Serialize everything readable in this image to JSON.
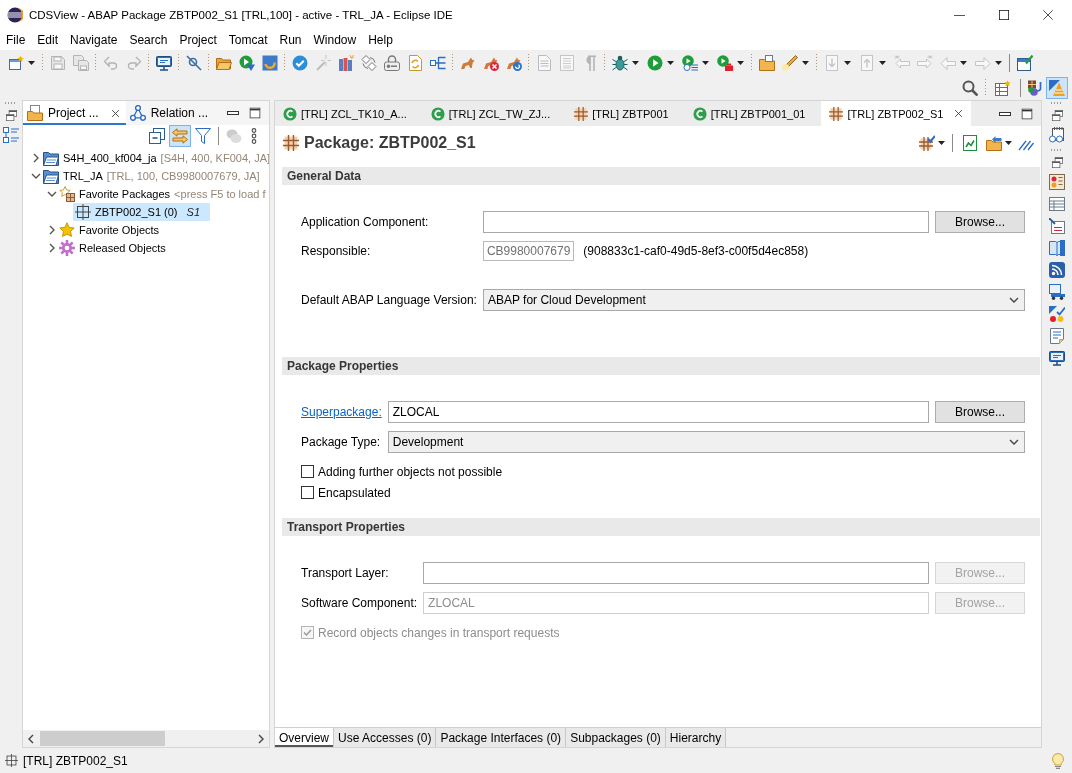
{
  "window": {
    "title": "CDSView - ABAP Package ZBTP002_S1 [TRL,100] - active - TRL_JA - Eclipse IDE"
  },
  "menu": [
    "File",
    "Edit",
    "Navigate",
    "Search",
    "Project",
    "Tomcat",
    "Run",
    "Window",
    "Help"
  ],
  "toolbar": {
    "groups": [
      [
        {
          "disabled": false
        }
      ],
      [
        {
          "disabled": true
        },
        {
          "disabled": true
        }
      ],
      [
        {
          "disabled": true
        },
        {
          "disabled": true
        }
      ],
      [
        {
          "disabled": false
        }
      ],
      [
        {
          "disabled": false
        }
      ],
      [
        {
          "disabled": false
        },
        {
          "disabled": false
        },
        {
          "disabled": false
        }
      ],
      [
        {
          "disabled": false
        },
        {
          "disabled": true
        },
        {
          "disabled": false
        },
        {
          "disabled": false
        },
        {
          "disabled": false
        },
        {
          "disabled": false
        },
        {
          "disabled": false
        }
      ],
      [
        {
          "disabled": false
        },
        {
          "disabled": false
        },
        {
          "disabled": false
        }
      ],
      [
        {
          "disabled": true
        },
        {
          "disabled": true
        },
        {
          "disabled": true
        }
      ],
      [
        {
          "disabled": false
        },
        {
          "disabled": false
        },
        {
          "disabled": false
        },
        {
          "disabled": false
        }
      ],
      [
        {
          "disabled": false
        },
        {
          "disabled": false
        }
      ],
      [
        {
          "disabled": true
        },
        {
          "disabled": true
        },
        {
          "disabled": true
        },
        {
          "disabled": true
        },
        {
          "disabled": true
        },
        {
          "disabled": true
        }
      ],
      [
        {
          "disabled": false
        }
      ]
    ]
  },
  "perspectives": [
    {
      "selected": false
    },
    {
      "selected": true
    }
  ],
  "left_panel": {
    "tabs": [
      {
        "label": "Project ...",
        "selected": true
      },
      {
        "label": "Relation ...",
        "selected": false
      }
    ],
    "toolbar": [
      {
        "on": false,
        "disabled": false
      },
      {
        "on": true,
        "disabled": false
      },
      {
        "on": false,
        "disabled": false
      },
      {
        "on": false,
        "disabled": true
      }
    ],
    "tree": [
      {
        "kind": "project",
        "label": "S4H_400_kf004_ja",
        "detail": "[S4H, 400, KF004, JA]",
        "expanded": false,
        "selected": false
      },
      {
        "kind": "project",
        "label": "TRL_JA",
        "detail": "[TRL, 100, CB9980007679, JA]",
        "expanded": true,
        "selected": false,
        "children": [
          {
            "kind": "packages",
            "label": "Favorite Packages",
            "detail": "<press F5 to load f",
            "expanded": true,
            "selected": false,
            "children": [
              {
                "kind": "package",
                "label": "ZBTP002_S1 (0)",
                "detail": "S1",
                "selected": true
              }
            ]
          },
          {
            "kind": "objects",
            "label": "Favorite Objects",
            "expanded": false,
            "selected": false
          },
          {
            "kind": "released",
            "label": "Released Objects",
            "expanded": false,
            "selected": false
          }
        ]
      }
    ]
  },
  "editor": {
    "tabs": [
      {
        "kind": "class",
        "label": "[TRL] ZCL_TK10_A...",
        "selected": false
      },
      {
        "kind": "class",
        "label": "[TRL] ZCL_TW_ZJ...",
        "selected": false
      },
      {
        "kind": "package",
        "label": "[TRL] ZBTP001",
        "selected": false
      },
      {
        "kind": "class",
        "label": "[TRL] ZBTP001_01",
        "selected": false
      },
      {
        "kind": "package",
        "label": "[TRL] ZBTP002_S1",
        "selected": true
      }
    ],
    "title": "Package: ZBTP002_S1",
    "sections": [
      {
        "title": "General Data",
        "rows": [
          {
            "kind": "text",
            "label": "Application Component:",
            "link": false,
            "disabled": false,
            "button": "Browse...",
            "button_disabled": false
          },
          {
            "kind": "readonly",
            "label": "Responsible:",
            "value": "CB9980007679",
            "note": "(908833c1-caf0-49d5-8ef3-c00f5d4ec858)"
          },
          {
            "kind": "select",
            "label": "Default ABAP Language Version:",
            "value": "ABAP for Cloud Development"
          }
        ]
      },
      {
        "title": "Package Properties",
        "rows": [
          {
            "kind": "text",
            "label": "Superpackage:",
            "link": true,
            "value": "ZLOCAL",
            "disabled": false,
            "button": "Browse...",
            "button_disabled": false
          },
          {
            "kind": "select",
            "label": "Package Type:",
            "value": "Development"
          },
          {
            "kind": "checkbox",
            "label": "Adding further objects not possible",
            "checked": false,
            "disabled": false
          },
          {
            "kind": "checkbox",
            "label": "Encapsulated",
            "checked": false,
            "disabled": false
          }
        ]
      },
      {
        "title": "Transport Properties",
        "rows": [
          {
            "kind": "text",
            "label": "Transport Layer:",
            "link": false,
            "disabled": false,
            "button": "Browse...",
            "button_disabled": true
          },
          {
            "kind": "text",
            "label": "Software Component:",
            "link": false,
            "value": "ZLOCAL",
            "disabled": true,
            "button": "Browse...",
            "button_disabled": true
          },
          {
            "kind": "checkbox",
            "label": "Record objects changes in transport requests",
            "checked": true,
            "disabled": true
          }
        ]
      }
    ],
    "page_tabs": [
      {
        "label": "Overview",
        "selected": true
      },
      {
        "label": "Use Accesses (0)",
        "selected": false
      },
      {
        "label": "Package Interfaces (0)",
        "selected": false
      },
      {
        "label": "Subpackages (0)",
        "selected": false
      },
      {
        "label": "Hierarchy",
        "selected": false
      }
    ]
  },
  "status_bar": {
    "text": "[TRL] ZBTP002_S1"
  }
}
